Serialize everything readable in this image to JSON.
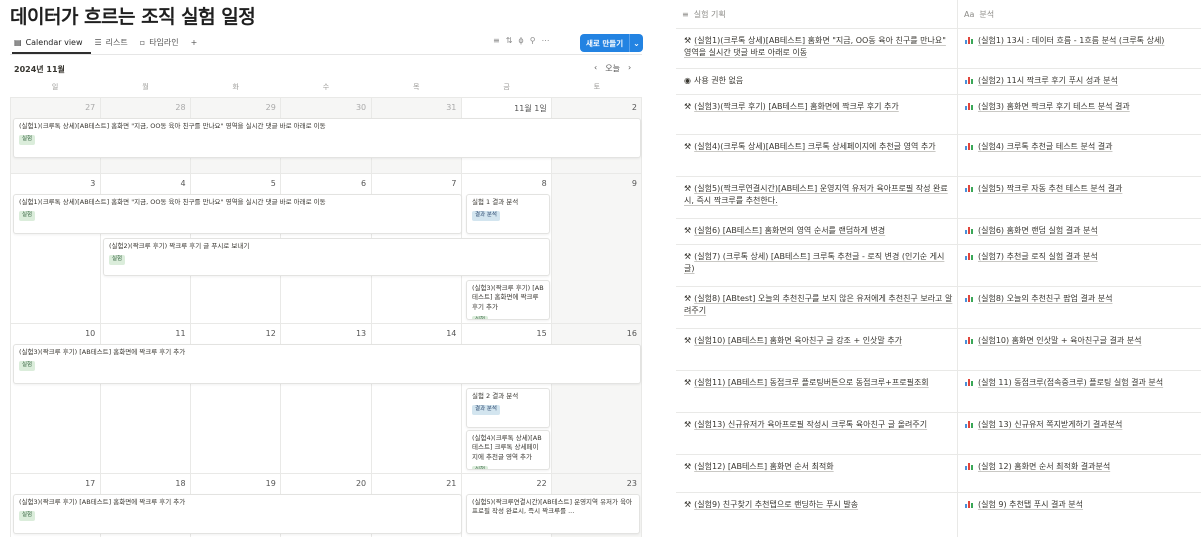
{
  "calendar": {
    "title": "데이터가 흐르는 조직 실험 일정",
    "views": [
      "Calendar view",
      "리스트",
      "타임라인"
    ],
    "add_view": "+",
    "new_button": "새로 만들기",
    "month_label": "2024년 11월",
    "today_label": "오늘",
    "weekdays": [
      "일",
      "월",
      "화",
      "수",
      "목",
      "금",
      "토"
    ],
    "weeks": [
      {
        "days": [
          "27",
          "28",
          "29",
          "30",
          "31",
          "11월 1일",
          "2"
        ],
        "events": [
          {
            "title": "(실험1)(크루톡 상세)[AB테스트] 홈화면 \"지금, OO동 육아 친구를 만나요\" 영역을 실시간 댓글 바로 아래로 이동",
            "tag": "실험"
          }
        ]
      },
      {
        "days": [
          "3",
          "4",
          "5",
          "6",
          "7",
          "8",
          "9"
        ],
        "events": [
          {
            "title": "(실험1)(크루톡 상세)[AB테스트] 홈화면 \"지금, OO동 육아 친구를 만나요\" 영역을 실시간 댓글 바로 아래로 이동",
            "tag": "실험"
          },
          {
            "title": "실험 1 결과 분석",
            "tag": "결과 분석"
          },
          {
            "title": "(실험2)(짝크루 후기) 짝크루 후기 글 푸시로 보내기",
            "tag": "실험"
          },
          {
            "title": "(실험3)(짝크루 후기) [AB테스트] 홈화면에 짝크루 후기 추가",
            "tag": "실험"
          }
        ]
      },
      {
        "days": [
          "10",
          "11",
          "12",
          "13",
          "14",
          "15",
          "16"
        ],
        "events": [
          {
            "title": "(실험3)(짝크루 후기) [AB테스트] 홈화면에 짝크루 후기 추가",
            "tag": "실험"
          },
          {
            "title": "실험 2 결과 분석",
            "tag": "결과 분석"
          },
          {
            "title": "(실험4)(크루톡 상세)[AB테스트] 크루톡 상세페이지에 추천글 영역 추가",
            "tag": "실험"
          }
        ]
      },
      {
        "days": [
          "17",
          "18",
          "19",
          "20",
          "21",
          "22",
          "23"
        ],
        "events": [
          {
            "title": "(실험3)(짝크루 후기) [AB테스트] 홈화면에 짝크루 후기 추가",
            "tag": "실험"
          },
          {
            "title": "(실험5)(짝크루연결시간)[AB테스트] 운영지역 유저가 육아프로필 작성 완료시, 즉시 짝크루를 ...",
            "tag": ""
          }
        ]
      }
    ]
  },
  "table": {
    "col1_header": "실험 기획",
    "col2_header": "분석",
    "col2_header_icon": "Aa",
    "rows": [
      {
        "plan": "(실험1)(크루톡 상세)[AB테스트] 홈화면 \"지금, OO동 육아 친구를 만나요\" 영역을 실시간 댓글 바로 아래로 이동",
        "plan_icon": "hammer-icon",
        "analysis": "(실험1) 13시 : 데이터 흐름 - 1흐름 분석 (크루톡 상세)"
      },
      {
        "plan": "사용 권한 없음",
        "plan_icon": "eye-icon",
        "analysis": "(실험2) 11시 짝크루 후기 푸시 성과 분석"
      },
      {
        "plan": "(실험3)(짝크루 후기) [AB테스트] 홈화면에 짝크루 후기 추가",
        "plan_icon": "hammer-icon",
        "analysis": "(실험3) 홈화면 짝크루 후기 테스트 분석 결과"
      },
      {
        "plan": "(실험4)(크루톡 상세)[AB테스트] 크루톡 상세페이지에 추천글 영역 추가",
        "plan_icon": "hammer-icon",
        "analysis": "(실험4) 크루톡 추천글 테스트 분석 결과"
      },
      {
        "plan": "(실험5)(짝크루연결시간)[AB테스트] 운영지역 유저가 육아프로필 작성 완료시, 즉시 짝크루를 추천한다.",
        "plan_icon": "hammer-icon",
        "analysis": "(실험5) 짝크루 자동 추천 테스트 분석 결과"
      },
      {
        "plan": "(실험6) [AB테스트] 홈화면의 영역 순서를 랜덤하게 변경",
        "plan_icon": "hammer-icon",
        "analysis": "(실험6) 홈화면 랜덤 실험 결과 분석"
      },
      {
        "plan": "(실험7) (크루톡 상세) [AB테스트] 크루톡 추천글 - 로직 변경 (인기순 게시글)",
        "plan_icon": "hammer-icon",
        "analysis": "(실험7) 추천글 로직 실험 결과 분석"
      },
      {
        "plan": "(실험8) [ABtest] 오늘의 추천친구를 보지 않은 유저에게 추천친구 보라고 알려주기",
        "plan_icon": "hammer-icon",
        "analysis": "(실험8) 오늘의 추천친구 팝업 결과 분석"
      },
      {
        "plan": "(실험10) [AB테스트] 홈화면 육아친구 글 강조 + 인삿말 추가",
        "plan_icon": "hammer-icon",
        "analysis": "(실험10) 홈화면 인삿말 + 육아친구글 결과 분석"
      },
      {
        "plan": "(실험11) [AB테스트] 동접크루 플로팅버튼으로 동접크루+프로필조회",
        "plan_icon": "hammer-icon",
        "analysis": "(실험 11) 동접크루(접속중크루) 플로팅 실험 결과 분석"
      },
      {
        "plan": "(실험13) 신규유저가 육아프로필 작성시 크루톡 육아친구 글 올려주기",
        "plan_icon": "hammer-icon",
        "analysis": "(실험 13) 신규유저 쪽지받게하기 결과분석"
      },
      {
        "plan": "(실험12) [AB테스트] 홈화면 순서 최적화",
        "plan_icon": "hammer-icon",
        "analysis": "(실험 12) 홈화면 순서 최적화 결과분석"
      },
      {
        "plan": "(실험9) 친구찾기 추천탭으로 랜딩하는 푸시 발송",
        "plan_icon": "hammer-icon",
        "analysis": "(실험 9) 추천탭 푸시 결과 분석"
      }
    ]
  }
}
